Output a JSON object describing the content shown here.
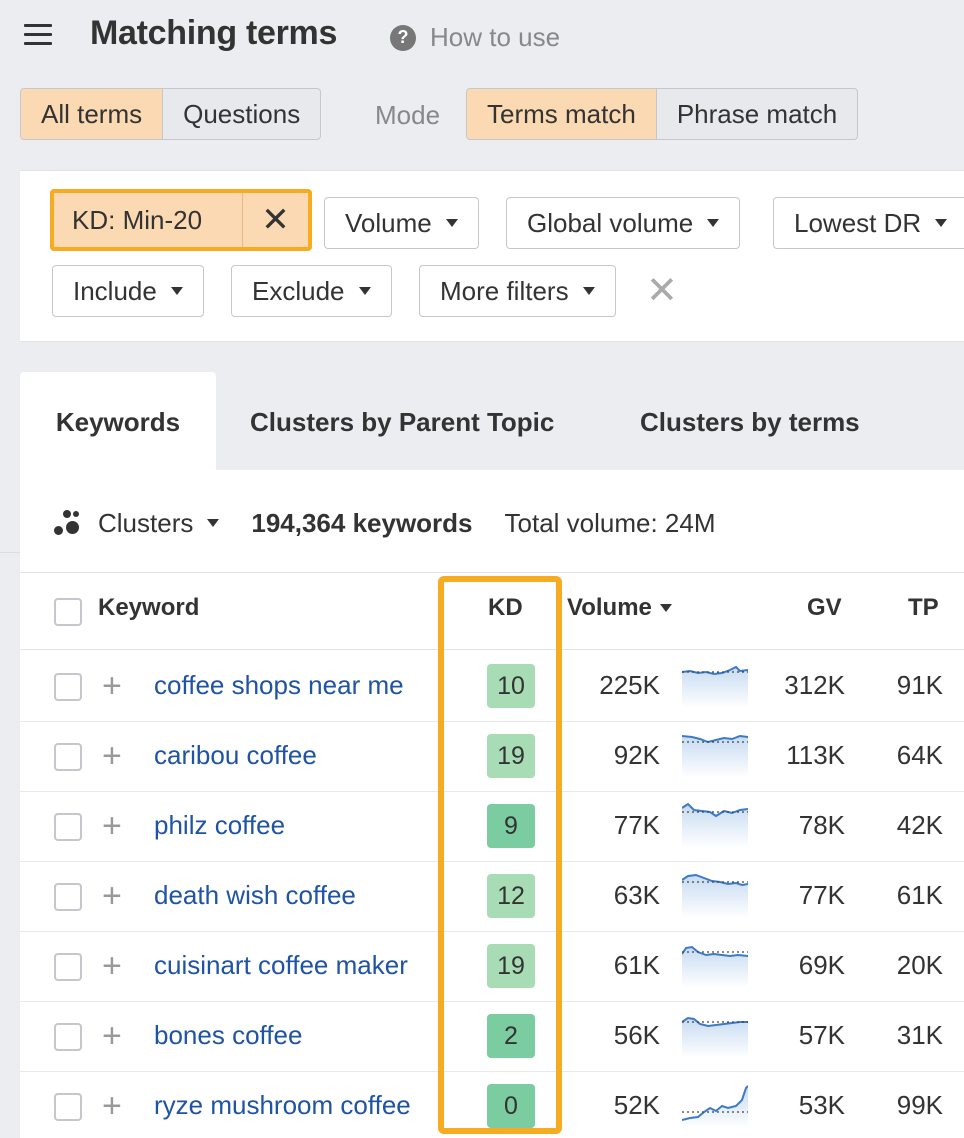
{
  "header": {
    "title": "Matching terms",
    "help_label": "How to use",
    "menu_icon": "hamburger-icon",
    "help_icon": "question-icon"
  },
  "terms_toggle": {
    "all_terms": "All terms",
    "questions": "Questions",
    "active": "All terms"
  },
  "mode": {
    "label": "Mode",
    "terms_match": "Terms match",
    "phrase_match": "Phrase match",
    "active": "Terms match"
  },
  "filters": {
    "kd": "KD: Min-20",
    "volume": "Volume",
    "global_volume": "Global volume",
    "lowest_dr": "Lowest DR",
    "include": "Include",
    "exclude": "Exclude",
    "more_filters": "More filters"
  },
  "tabs": [
    "Keywords",
    "Clusters by Parent Topic",
    "Clusters by terms"
  ],
  "summary": {
    "clusters_label": "Clusters",
    "keywords_count": "194,364 keywords",
    "total_volume": "Total volume: 24M"
  },
  "columns": {
    "keyword": "Keyword",
    "kd": "KD",
    "volume": "Volume",
    "gv": "GV",
    "tp": "TP"
  },
  "colors": {
    "accent": "#f7ab21",
    "active_tab": "#fbd9b2",
    "link": "#1f53a3",
    "kd_light": "#a8dcb4",
    "kd_dark": "#7ccca1"
  },
  "rows": [
    {
      "keyword": "coffee shops near me",
      "kd": "10",
      "volume": "225K",
      "gv": "312K",
      "tp": "91K"
    },
    {
      "keyword": "caribou coffee",
      "kd": "19",
      "volume": "92K",
      "gv": "113K",
      "tp": "64K"
    },
    {
      "keyword": "philz coffee",
      "kd": "9",
      "volume": "77K",
      "gv": "78K",
      "tp": "42K"
    },
    {
      "keyword": "death wish coffee",
      "kd": "12",
      "volume": "63K",
      "gv": "77K",
      "tp": "61K"
    },
    {
      "keyword": "cuisinart coffee maker",
      "kd": "19",
      "volume": "61K",
      "gv": "69K",
      "tp": "20K"
    },
    {
      "keyword": "bones coffee",
      "kd": "2",
      "volume": "56K",
      "gv": "57K",
      "tp": "31K"
    },
    {
      "keyword": "ryze mushroom coffee",
      "kd": "0",
      "volume": "52K",
      "gv": "53K",
      "tp": "99K"
    }
  ]
}
